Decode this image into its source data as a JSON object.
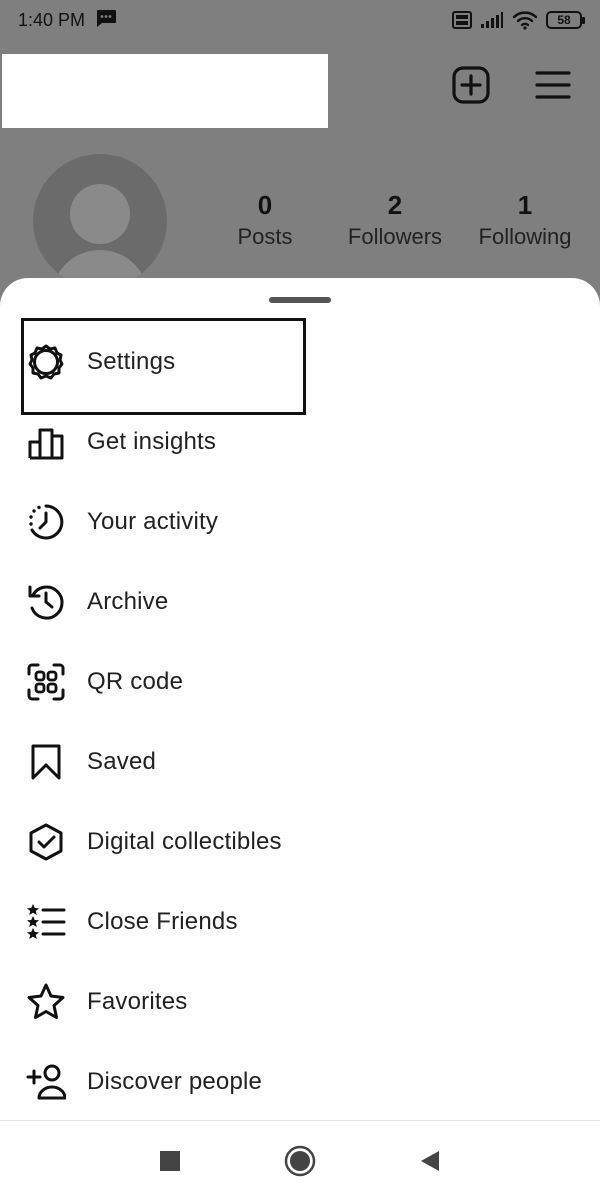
{
  "status_bar": {
    "time": "1:40 PM",
    "battery": "58"
  },
  "profile": {
    "stats": [
      {
        "value": "0",
        "label": "Posts"
      },
      {
        "value": "2",
        "label": "Followers"
      },
      {
        "value": "1",
        "label": "Following"
      }
    ]
  },
  "menu": {
    "items": [
      {
        "label": "Settings",
        "icon": "settings-gear-icon"
      },
      {
        "label": "Get insights",
        "icon": "bar-chart-icon"
      },
      {
        "label": "Your activity",
        "icon": "activity-clock-icon"
      },
      {
        "label": "Archive",
        "icon": "archive-history-icon"
      },
      {
        "label": "QR code",
        "icon": "qr-code-icon"
      },
      {
        "label": "Saved",
        "icon": "bookmark-icon"
      },
      {
        "label": "Digital collectibles",
        "icon": "verified-badge-icon"
      },
      {
        "label": "Close Friends",
        "icon": "star-list-icon"
      },
      {
        "label": "Favorites",
        "icon": "star-icon"
      },
      {
        "label": "Discover people",
        "icon": "add-person-icon"
      }
    ]
  },
  "colors": {
    "backdrop": "#7f7f7f",
    "sheet": "#ffffff",
    "text": "#222222"
  }
}
